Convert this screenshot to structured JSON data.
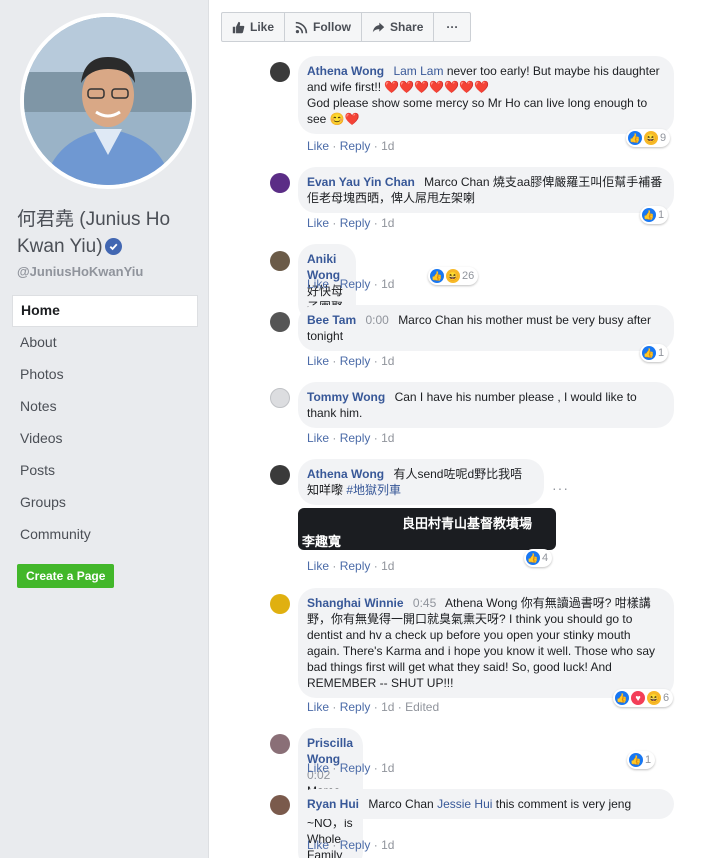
{
  "page": {
    "name": "何君堯 (Junius Ho Kwan Yiu)",
    "handle": "@JuniusHoKwanYiu",
    "nav": [
      "Home",
      "About",
      "Photos",
      "Notes",
      "Videos",
      "Posts",
      "Groups",
      "Community"
    ],
    "active_nav": "Home",
    "create_page_label": "Create a Page"
  },
  "actions": {
    "like": "Like",
    "follow": "Follow",
    "share": "Share",
    "more": "···"
  },
  "ui": {
    "like": "Like",
    "reply": "Reply",
    "sep": "·",
    "more_dots": "···"
  },
  "comments": [
    {
      "author": "Athena Wong",
      "mention": "Lam Lam",
      "text": " never too early! But maybe his daughter and wife first!! ❤️❤️❤️❤️❤️❤️❤️",
      "text2": "God please show some mercy so Mr Ho can live long enough to see 😊❤️",
      "time": "1d",
      "react_count": "9"
    },
    {
      "author": "Evan Yau Yin Chan",
      "text": "Marco Chan 燒支aa膠俾嚴羅王叫佢幫手補番佢老母塊西晒，俾人屌甩左架喇",
      "time": "1d",
      "react_count": "1"
    },
    {
      "author": "Aniki Wong",
      "text": "好快母子團聚",
      "time": "1d",
      "react_count": "26"
    },
    {
      "author": "Bee Tam",
      "timestamp": "0:00",
      "text": "Marco Chan his mother must be very busy after tonight",
      "time": "1d",
      "react_count": "1"
    },
    {
      "author": "Tommy Wong",
      "text": "Can I have his number please , I would like to thank him.",
      "time": "1d"
    },
    {
      "author": "Athena Wong",
      "text": "有人send咗呢d野比我唔知咩嚟",
      "hashtag": "#地獄列車",
      "time": "1d",
      "react_count": "4",
      "attachment": {
        "line1": "良田村青山基督教墳場",
        "line2": "李趣寬"
      }
    },
    {
      "author": "Shanghai Winnie",
      "timestamp": "0:45",
      "text": "Athena Wong 你有無讀過書呀? 咁樣講野，你有無覺得一開口就臭氣熏天呀? I think you should go to dentist and hv a check up before you open your stinky mouth again. There's Karma and i hope you know it well. Those who say bad things first will get what they said! So, good luck! And REMEMBER -- SHUT UP!!!",
      "time": "1d",
      "edited": "Edited",
      "react_count": "6"
    },
    {
      "author": "Priscilla Wong",
      "timestamp": "0:02",
      "text": "Marco Chan ~NO，is Whole Family",
      "time": "1d",
      "react_count": "1"
    },
    {
      "author": "Ryan Hui",
      "text_pre": "Marco Chan ",
      "mention": "Jessie Hui",
      "text": " this comment is very jeng",
      "time": "1d"
    }
  ],
  "colors": {
    "link": "#385898",
    "sidebar_bg": "#e9ebee",
    "bubble_bg": "#f2f3f5",
    "create_btn": "#42b72a"
  }
}
